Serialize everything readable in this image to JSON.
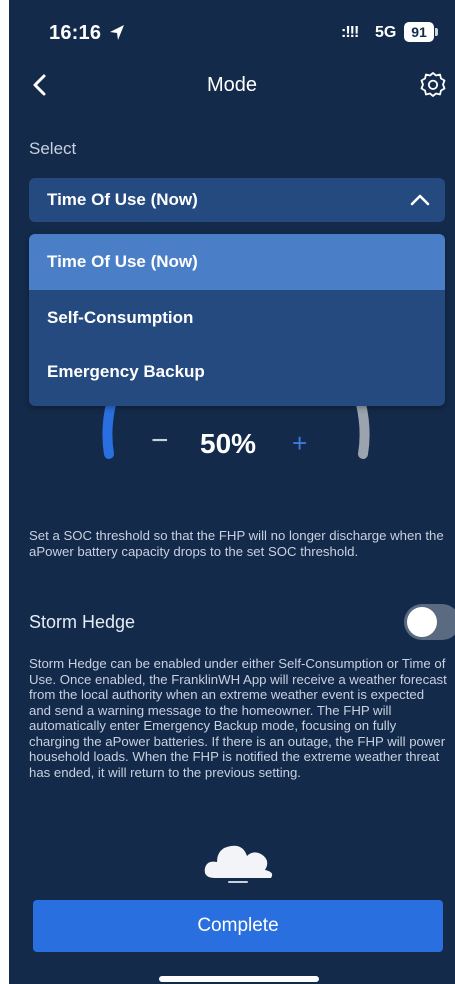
{
  "status_bar": {
    "time": "16:16",
    "signal": ":!!!",
    "network": "5G",
    "battery": "91"
  },
  "header": {
    "title": "Mode",
    "icons": {
      "back": "chevron-left-icon",
      "settings": "gear-icon"
    }
  },
  "select": {
    "label": "Select",
    "current_value": "Time Of Use (Now)",
    "options": [
      {
        "label": "Time Of Use (Now)",
        "selected": true
      },
      {
        "label": "Self-Consumption",
        "selected": false
      },
      {
        "label": "Emergency Backup",
        "selected": false
      }
    ]
  },
  "soc": {
    "minus": "−",
    "percent_label": "50%",
    "plus": "+",
    "description": "Set a SOC threshold so that the FHP will no longer discharge when the aPower battery capacity drops to the set SOC threshold."
  },
  "storm_hedge": {
    "label": "Storm Hedge",
    "enabled": false,
    "description": "Storm Hedge can be enabled under either Self-Consumption or Time of Use. Once enabled, the FranklinWH App will receive a weather forecast from the local authority when an extreme weather event is expected and send a warning message to the homeowner. The FHP will automatically enter Emergency Backup mode, focusing on fully charging the aPower batteries. If there is an outage, the FHP will power household loads. When the FHP is notified the extreme weather threat has ended, it will return to the previous setting."
  },
  "complete_button": {
    "label": "Complete"
  },
  "colors": {
    "background": "#132a4a",
    "panel": "#244a80",
    "selected": "#4a7fc7",
    "accent": "#2a6fe0"
  }
}
